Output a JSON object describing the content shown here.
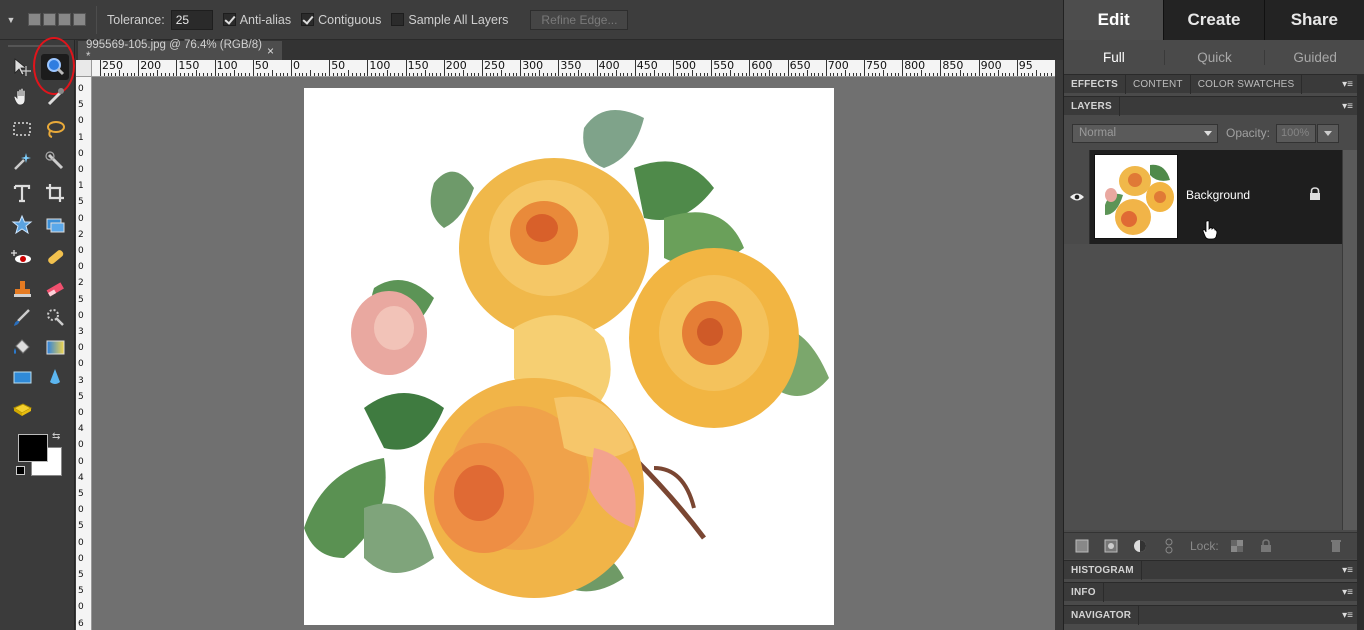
{
  "options_bar": {
    "tolerance_label": "Tolerance:",
    "tolerance_value": "25",
    "anti_alias_label": "Anti-alias",
    "anti_alias_checked": true,
    "contiguous_label": "Contiguous",
    "contiguous_checked": true,
    "sample_all_layers_label": "Sample All Layers",
    "sample_all_layers_checked": false,
    "refine_edge_label": "Refine Edge..."
  },
  "document": {
    "tab_title": "995569-105.jpg @ 76.4% (RGB/8) *",
    "close_glyph": "×"
  },
  "ruler": {
    "horizontal_labels": [
      "250",
      "200",
      "150",
      "100",
      "50",
      "0",
      "50",
      "100",
      "150",
      "200",
      "250",
      "300",
      "350",
      "400",
      "450",
      "500",
      "550",
      "600",
      "650",
      "700",
      "750",
      "800",
      "850",
      "900",
      "95"
    ],
    "vertical_labels": [
      "0",
      "5",
      "0",
      "1",
      "0",
      "0",
      "1",
      "5",
      "0",
      "2",
      "0",
      "0",
      "2",
      "5",
      "0",
      "3",
      "0",
      "0",
      "3",
      "5",
      "0",
      "4",
      "0",
      "0",
      "4",
      "5",
      "0",
      "5",
      "0",
      "0",
      "5",
      "5",
      "0",
      "6"
    ]
  },
  "right_panel": {
    "mode_tabs": [
      "Edit",
      "Create",
      "Share"
    ],
    "active_mode": "Edit",
    "sub_tabs": [
      "Full",
      "Quick",
      "Guided"
    ],
    "active_sub": "Full",
    "top_panel_tabs": [
      "EFFECTS",
      "CONTENT",
      "COLOR SWATCHES"
    ],
    "layers_tab": "LAYERS",
    "blend_mode": "Normal",
    "opacity_label": "Opacity:",
    "opacity_value": "100%",
    "layer_name": "Background",
    "lock_label": "Lock:",
    "histogram_tab": "HISTOGRAM",
    "info_tab": "INFO",
    "navigator_tab": "NAVIGATOR"
  },
  "colors": {
    "accent_highlight": "#e0141b",
    "foreground_color": "#000000",
    "background_color": "#ffffff"
  }
}
